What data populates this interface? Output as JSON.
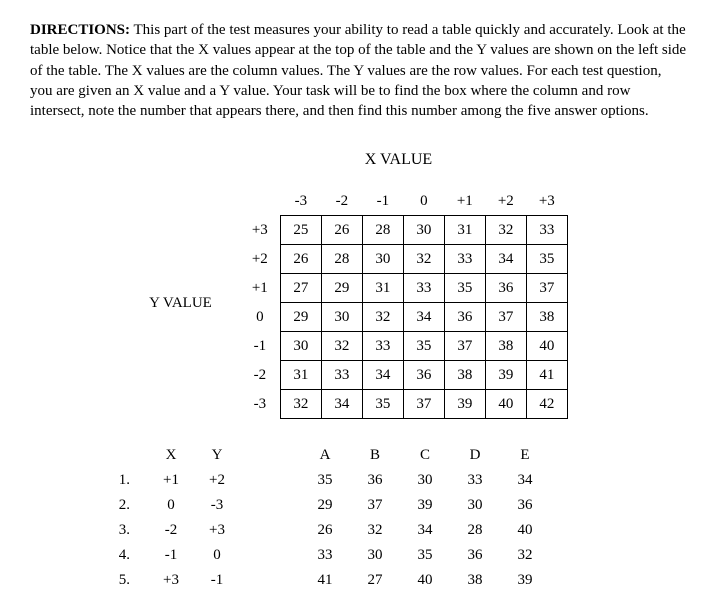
{
  "directions": {
    "label": "DIRECTIONS:",
    "text": " This part of the test measures your ability to read a table quickly and accurately.  Look at the table below.  Notice that the X values appear at the top of the table and the Y values are shown on the left side of the table.  The X values are the column values.  The Y values are the row values.  For each test question, you are given an X value and a Y value.  Your task will be to find the box where the column and row intersect, note the number that appears there, and then find this number among the five answer options."
  },
  "labels": {
    "xvalue": "X VALUE",
    "yvalue": "Y VALUE",
    "X": "X",
    "Y": "Y",
    "A": "A",
    "B": "B",
    "C": "C",
    "D": "D",
    "E": "E"
  },
  "chart_data": {
    "type": "table",
    "x_headers": [
      "-3",
      "-2",
      "-1",
      "0",
      "+1",
      "+2",
      "+3"
    ],
    "y_headers": [
      "+3",
      "+2",
      "+1",
      "0",
      "-1",
      "-2",
      "-3"
    ],
    "rows": [
      [
        "25",
        "26",
        "28",
        "30",
        "31",
        "32",
        "33"
      ],
      [
        "26",
        "28",
        "30",
        "32",
        "33",
        "34",
        "35"
      ],
      [
        "27",
        "29",
        "31",
        "33",
        "35",
        "36",
        "37"
      ],
      [
        "29",
        "30",
        "32",
        "34",
        "36",
        "37",
        "38"
      ],
      [
        "30",
        "32",
        "33",
        "35",
        "37",
        "38",
        "40"
      ],
      [
        "31",
        "33",
        "34",
        "36",
        "38",
        "39",
        "41"
      ],
      [
        "32",
        "34",
        "35",
        "37",
        "39",
        "40",
        "42"
      ]
    ]
  },
  "questions": [
    {
      "n": "1.",
      "x": "+1",
      "y": "+2",
      "A": "35",
      "B": "36",
      "C": "30",
      "D": "33",
      "E": "34"
    },
    {
      "n": "2.",
      "x": "0",
      "y": "-3",
      "A": "29",
      "B": "37",
      "C": "39",
      "D": "30",
      "E": "36"
    },
    {
      "n": "3.",
      "x": "-2",
      "y": "+3",
      "A": "26",
      "B": "32",
      "C": "34",
      "D": "28",
      "E": "40"
    },
    {
      "n": "4.",
      "x": "-1",
      "y": "0",
      "A": "33",
      "B": "30",
      "C": "35",
      "D": "36",
      "E": "32"
    },
    {
      "n": "5.",
      "x": "+3",
      "y": "-1",
      "A": "41",
      "B": "27",
      "C": "40",
      "D": "38",
      "E": "39"
    }
  ]
}
